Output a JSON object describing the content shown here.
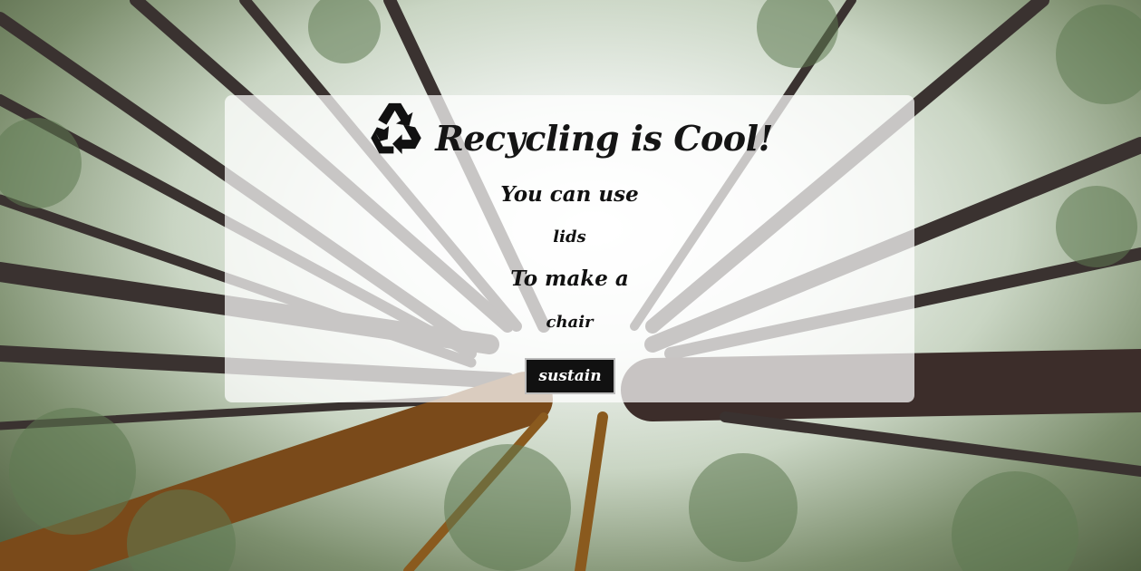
{
  "header": {
    "title": "Recycling is Cool!",
    "icon": "recycle-icon"
  },
  "content": {
    "line1": "You can use",
    "line2": "lids",
    "line3": "To make a",
    "line4": "chair"
  },
  "actions": {
    "sustain_label": "sustain"
  },
  "colors": {
    "card_background": "#ffffff",
    "button_background": "#111111",
    "text": "#151515"
  }
}
